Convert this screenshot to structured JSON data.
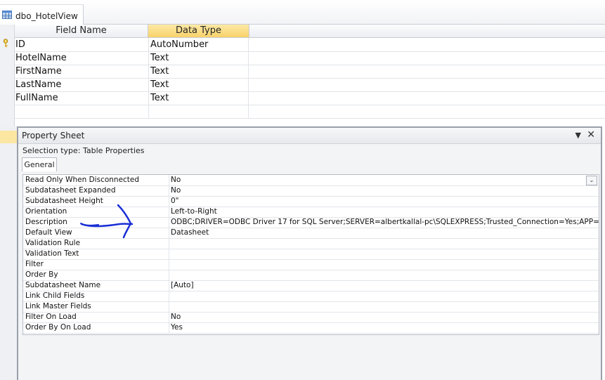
{
  "tab": {
    "title": "dbo_HotelView",
    "icon": "table-icon"
  },
  "grid": {
    "headers": {
      "field_name": "Field Name",
      "data_type": "Data Type"
    },
    "rows": [
      {
        "field": "ID",
        "type": "AutoNumber"
      },
      {
        "field": "HotelName",
        "type": "Text"
      },
      {
        "field": "FirstName",
        "type": "Text"
      },
      {
        "field": "LastName",
        "type": "Text"
      },
      {
        "field": "FullName",
        "type": "Text"
      }
    ]
  },
  "property_sheet": {
    "title": "Property Sheet",
    "selection_type": "Selection type:  Table Properties",
    "tab_general": "General",
    "properties": [
      {
        "name": "Read Only When Disconnected",
        "value": "No"
      },
      {
        "name": "Subdatasheet Expanded",
        "value": "No"
      },
      {
        "name": "Subdatasheet Height",
        "value": "0\""
      },
      {
        "name": "Orientation",
        "value": "Left-to-Right"
      },
      {
        "name": "Description",
        "value": "ODBC;DRIVER=ODBC Driver 17 for SQL Server;SERVER=albertkallal-pc\\SQLEXPRESS;Trusted_Connection=Yes;APP=Micro"
      },
      {
        "name": "Default View",
        "value": "Datasheet"
      },
      {
        "name": "Validation Rule",
        "value": ""
      },
      {
        "name": "Validation Text",
        "value": ""
      },
      {
        "name": "Filter",
        "value": ""
      },
      {
        "name": "Order By",
        "value": ""
      },
      {
        "name": "Subdatasheet Name",
        "value": "[Auto]"
      },
      {
        "name": "Link Child Fields",
        "value": ""
      },
      {
        "name": "Link Master Fields",
        "value": ""
      },
      {
        "name": "Filter On Load",
        "value": "No"
      },
      {
        "name": "Order By On Load",
        "value": "Yes"
      }
    ]
  },
  "colors": {
    "header_highlight": "#f8d26a",
    "annotation_ink": "#1a2fd6"
  }
}
